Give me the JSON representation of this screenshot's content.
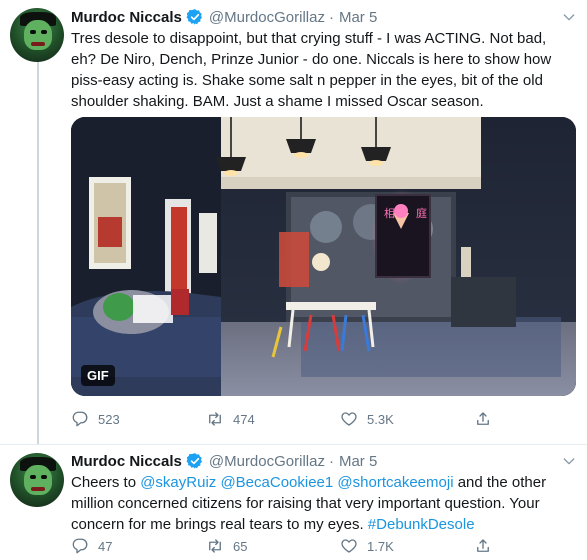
{
  "tweets": [
    {
      "author_name": "Murdoc Niccals",
      "handle": "@MurdocGorillaz",
      "separator": "·",
      "date": "Mar 5",
      "text_lines": [
        "Tres desole to disappoint, but that crying stuff - I was ACTING. Not bad,",
        "eh? De Niro, Dench, Prinze Junior - do one. Niccals is here to show how",
        "piss-easy acting is. Shake some salt n pepper in the eyes, bit of the old",
        "shoulder shaking. BAM. Just a shame I missed Oscar season."
      ],
      "media_badge": "GIF",
      "reply_count": "523",
      "retweet_count": "474",
      "like_count": "5.3K"
    },
    {
      "author_name": "Murdoc Niccals",
      "handle": "@MurdocGorillaz",
      "separator": "·",
      "date": "Mar 5",
      "line1": {
        "pre": "Cheers to ",
        "mention1": "@skayRuiz",
        "sp1": " ",
        "mention2": "@BecaCookiee1",
        "sp2": " ",
        "mention3": "@shortcakeemoji",
        "post": " and the other"
      },
      "line2": "million concerned citizens for raising that very important question. Your",
      "line3": {
        "pre": "concern for me brings real tears to my eyes. ",
        "hashtag": "#DebunkDesole"
      },
      "reply_count": "47",
      "retweet_count": "65",
      "like_count": "1.7K"
    }
  ],
  "colors": {
    "text": "#14171a",
    "secondary": "#657786",
    "link": "#1b95e0",
    "verified": "#1da1f2",
    "divider": "#e6ecf0"
  },
  "icons": [
    "verified-badge-icon",
    "chevron-down-icon",
    "reply-icon",
    "retweet-icon",
    "like-icon",
    "share-icon"
  ]
}
